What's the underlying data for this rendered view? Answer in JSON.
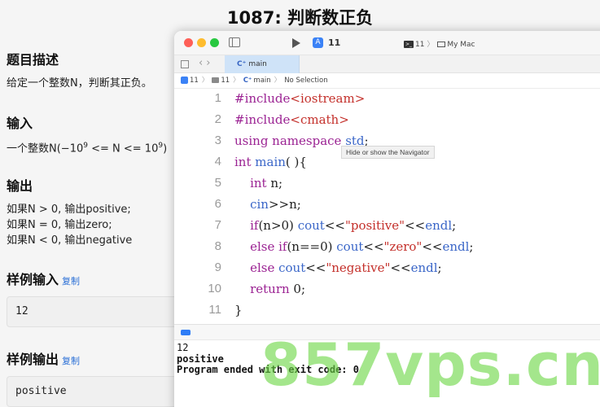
{
  "problem": {
    "title": "1087: 判断数正负",
    "description_heading": "题目描述",
    "description": "给定一个整数N，判断其正负。",
    "input_heading": "输入",
    "input_text": "一个整数N(−10",
    "input_exp1": "9",
    "input_mid": " <= N <= 10",
    "input_exp2": "9",
    "input_end": ")",
    "output_heading": "输出",
    "output_lines": [
      "如果N > 0, 输出positive;",
      "如果N = 0, 输出zero;",
      "如果N < 0, 输出negative"
    ],
    "sample_input_heading": "样例输入",
    "sample_input_copy": "复制",
    "sample_input_value": "12",
    "sample_output_heading": "样例输出",
    "sample_output_copy": "复制",
    "sample_output_value": "positive"
  },
  "xcode": {
    "scheme": "11",
    "destination_project": "11",
    "destination_device": "My Mac",
    "tab_label": "main",
    "jumpbar": {
      "project": "11",
      "folder": "11",
      "file": "main",
      "selection": "No Selection"
    },
    "tooltip": "Hide or show the Navigator",
    "code_lines": [
      {
        "n": "1"
      },
      {
        "n": "2"
      },
      {
        "n": "3"
      },
      {
        "n": "4"
      },
      {
        "n": "5"
      },
      {
        "n": "6"
      },
      {
        "n": "7"
      },
      {
        "n": "8"
      },
      {
        "n": "9"
      },
      {
        "n": "10"
      },
      {
        "n": "11"
      }
    ],
    "console_output": [
      "12",
      "positive",
      "Program ended with exit code: 0"
    ]
  },
  "watermark": "857vps.cn",
  "colors": {
    "keyword": "#9b2393",
    "type": "#3a66c8",
    "string": "#c4302b",
    "tab_active": "#cfe3f8",
    "accent": "#2f7df6",
    "watermark": "#6cd646"
  },
  "icons": [
    "sidebar-toggle-icon",
    "run-icon",
    "app-icon",
    "terminal-icon",
    "monitor-icon",
    "grid-icon",
    "back-icon",
    "forward-icon",
    "folder-icon",
    "console-toggle-icon"
  ]
}
